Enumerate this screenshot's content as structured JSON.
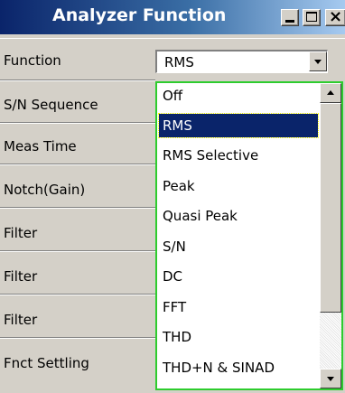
{
  "window": {
    "title": "Analyzer Function",
    "buttons": {
      "minimize": "minimize-icon",
      "maximize": "maximize-icon",
      "close": "close-icon"
    }
  },
  "fields": [
    {
      "label": "Function"
    },
    {
      "label": "S/N Sequence"
    },
    {
      "label": "Meas Time"
    },
    {
      "label": "Notch(Gain)"
    },
    {
      "label": "Filter"
    },
    {
      "label": "Filter"
    },
    {
      "label": "Filter"
    },
    {
      "label": "Fnct Settling"
    }
  ],
  "function_select": {
    "value": "RMS"
  },
  "dropdown": {
    "options": [
      "Off",
      "RMS",
      "RMS Selective",
      "Peak",
      "Quasi Peak",
      "S/N",
      "DC",
      "FFT",
      "THD",
      "THD+N & SINAD"
    ],
    "selected_index": 1,
    "accent_border": "#2ecc2e",
    "highlight_bg": "#0a246a"
  }
}
